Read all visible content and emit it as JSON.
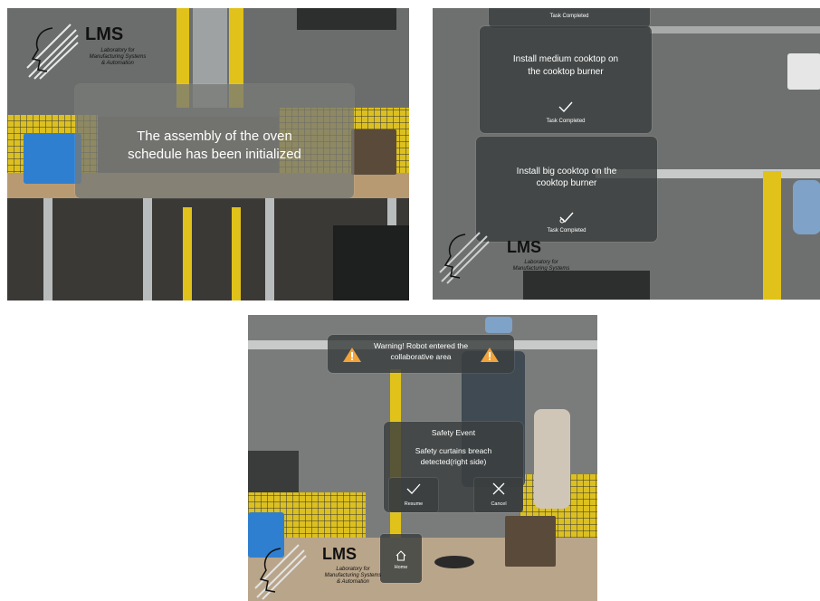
{
  "panel_a": {
    "logo": {
      "title": "LMS",
      "subtitle_line1": "Laboratory for",
      "subtitle_line2": "Manufacturing Systems",
      "subtitle_line3": "& Automation"
    },
    "message": {
      "line1": "The assembly of the oven",
      "line2": "schedule has been initialized"
    }
  },
  "panel_b": {
    "top_card": {
      "status": "Task Completed"
    },
    "card1": {
      "line1": "Install medium cooktop on",
      "line2": "the cooktop burner",
      "status": "Task Completed"
    },
    "card2": {
      "line1": "Install big cooktop on the",
      "line2": "cooktop burner",
      "status": "Task Completed"
    },
    "logo": {
      "title": "LMS",
      "subtitle_line1": "Laboratory for",
      "subtitle_line2": "Manufacturing Systems"
    }
  },
  "panel_c": {
    "warning": {
      "line1": "Warning! Robot entered the",
      "line2": "collaborative area"
    },
    "safety_dialog": {
      "title": "Safety Event",
      "line1": "Safety curtains breach",
      "line2": "detected(right side)",
      "resume_label": "Resume",
      "cancel_label": "Cancel"
    },
    "home_label": "Home",
    "logo": {
      "title": "LMS",
      "subtitle_line1": "Laboratory for",
      "subtitle_line2": "Manufacturing Systems",
      "subtitle_line3": "& Automation"
    }
  },
  "colors": {
    "accent_yellow": "#e1c21a",
    "warning_orange": "#f2a33a",
    "hologram_bg": "#3a3e3e",
    "bin_blue": "#2f7fd0"
  }
}
